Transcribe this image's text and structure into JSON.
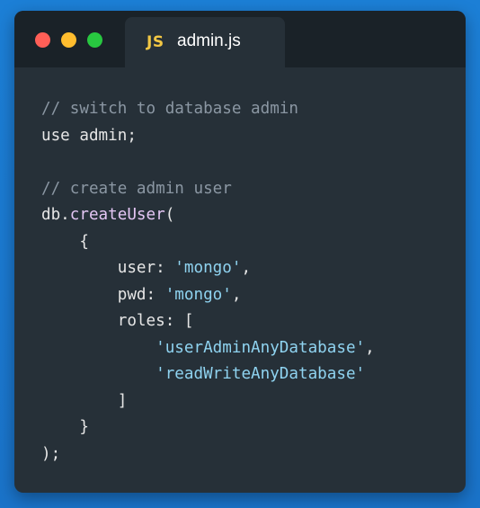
{
  "editor": {
    "tab": {
      "icon_text": "JS",
      "filename": "admin.js"
    },
    "code_lines": [
      [
        {
          "t": "// switch to database admin",
          "c": "comment"
        }
      ],
      [
        {
          "t": "use admin;",
          "c": "plain"
        }
      ],
      [],
      [
        {
          "t": "// create admin user",
          "c": "comment"
        }
      ],
      [
        {
          "t": "db.",
          "c": "plain"
        },
        {
          "t": "createUser",
          "c": "method"
        },
        {
          "t": "(",
          "c": "plain"
        }
      ],
      [
        {
          "t": "    {",
          "c": "plain"
        }
      ],
      [
        {
          "t": "        user: ",
          "c": "plain"
        },
        {
          "t": "'mongo'",
          "c": "string"
        },
        {
          "t": ",",
          "c": "plain"
        }
      ],
      [
        {
          "t": "        pwd: ",
          "c": "plain"
        },
        {
          "t": "'mongo'",
          "c": "string"
        },
        {
          "t": ",",
          "c": "plain"
        }
      ],
      [
        {
          "t": "        roles: [",
          "c": "plain"
        }
      ],
      [
        {
          "t": "            ",
          "c": "plain"
        },
        {
          "t": "'userAdminAnyDatabase'",
          "c": "string"
        },
        {
          "t": ",",
          "c": "plain"
        }
      ],
      [
        {
          "t": "            ",
          "c": "plain"
        },
        {
          "t": "'readWriteAnyDatabase'",
          "c": "string"
        }
      ],
      [
        {
          "t": "        ]",
          "c": "plain"
        }
      ],
      [
        {
          "t": "    }",
          "c": "plain"
        }
      ],
      [
        {
          "t": ");",
          "c": "plain"
        }
      ]
    ]
  },
  "colors": {
    "background": "#1c7fd6",
    "window": "#263038",
    "titlebar": "#1a2228",
    "close": "#ff5f57",
    "minimize": "#ffbd2e",
    "maximize": "#28c840",
    "comment": "#8b97a3",
    "string": "#8fd3f0",
    "method": "#e4c6f4",
    "js_icon": "#f2c744"
  }
}
